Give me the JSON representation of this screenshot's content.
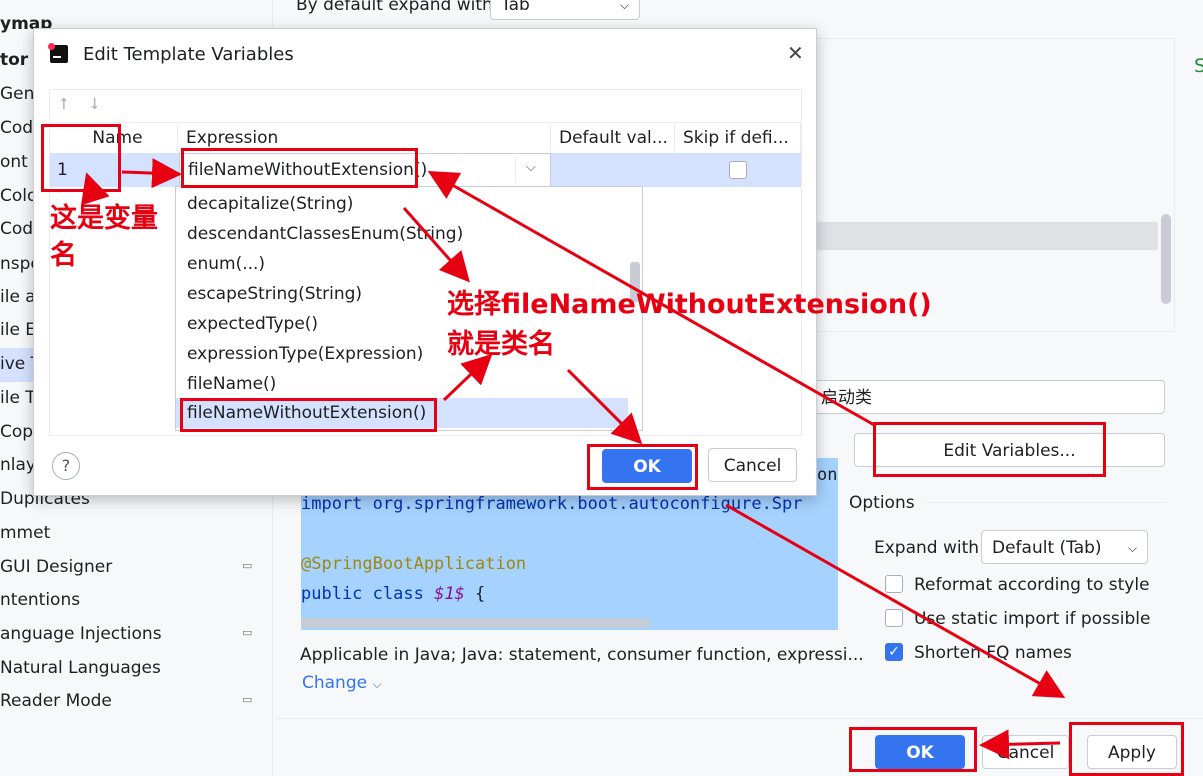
{
  "sidebar": {
    "items": [
      {
        "label": "ymap",
        "bold": true
      },
      {
        "label": "tor",
        "bold": true
      },
      {
        "label": "Gene"
      },
      {
        "label": "Code"
      },
      {
        "label": "ont"
      },
      {
        "label": "Colo"
      },
      {
        "label": "Code"
      },
      {
        "label": "nspe"
      },
      {
        "label": "ile a"
      },
      {
        "label": "ile E"
      },
      {
        "label": "ive T"
      },
      {
        "label": "ile T"
      },
      {
        "label": "Copy"
      },
      {
        "label": "nlay"
      },
      {
        "label": "Duplicates"
      },
      {
        "label": "mmet"
      },
      {
        "label": "GUI Designer"
      },
      {
        "label": "ntentions"
      },
      {
        "label": "anguage Injections"
      },
      {
        "label": "Natural Languages"
      },
      {
        "label": "Reader Mode"
      }
    ]
  },
  "main": {
    "expand_label": "By default expand with",
    "expand_value": "Tab",
    "desc_value": "启动类",
    "edit_variables": "Edit Variables...",
    "options_title": "Options",
    "expand_with_label": "Expand with",
    "expand_with_value": "Default (Tab)",
    "opt_reformat": "Reformat according to style",
    "opt_static": "Use static import if possible",
    "opt_shorten": "Shorten FQ names",
    "code_line1": "import org.springframework.boot.autoconfigure.Spr",
    "code_line_partial": "on",
    "code_line3": "@SpringBootApplication",
    "code_line4_kw": "public class",
    "code_line4_var": "$1$",
    "code_line4_rest": "{",
    "applicable": "Applicable in Java; Java: statement, consumer function, expressi...",
    "change": "Change",
    "ok": "OK",
    "cancel": "Cancel",
    "apply": "Apply",
    "green_char": "S"
  },
  "dialog": {
    "title": "Edit Template Variables",
    "columns": [
      "Name",
      "Expression",
      "Default val...",
      "Skip if defi..."
    ],
    "row": {
      "name": "1",
      "expression": "fileNameWithoutExtension()"
    },
    "popup_items": [
      "decapitalize(String)",
      "descendantClassesEnum(String)",
      "enum(...)",
      "escapeString(String)",
      "expectedType()",
      "expressionType(Expression)",
      "fileName()",
      "fileNameWithoutExtension()"
    ],
    "ok": "OK",
    "cancel": "Cancel",
    "help": "?"
  },
  "annotations": {
    "var_name_1": "这是变量",
    "var_name_2": "名",
    "choose_1": "选择fileNameWithoutExtension()",
    "choose_2": "就是类名"
  },
  "colors": {
    "accent": "#3574f0",
    "annotation": "#e60012",
    "selection": "#d4e2ff"
  }
}
